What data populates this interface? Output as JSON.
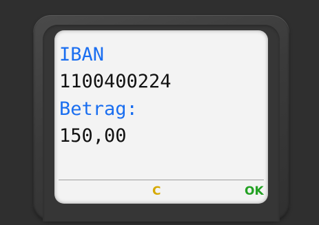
{
  "display": {
    "iban_label": "IBAN",
    "iban_value": "1100400224",
    "amount_label": "Betrag:",
    "amount_value": "150,00"
  },
  "softkeys": {
    "clear_label": "C",
    "ok_label": "OK"
  },
  "colors": {
    "label": "#1a6ef0",
    "value": "#111111",
    "clear_key": "#d6a900",
    "ok_key": "#23a123",
    "screen_bg": "#f3f3f3",
    "bezel": "#3a3a3a"
  }
}
